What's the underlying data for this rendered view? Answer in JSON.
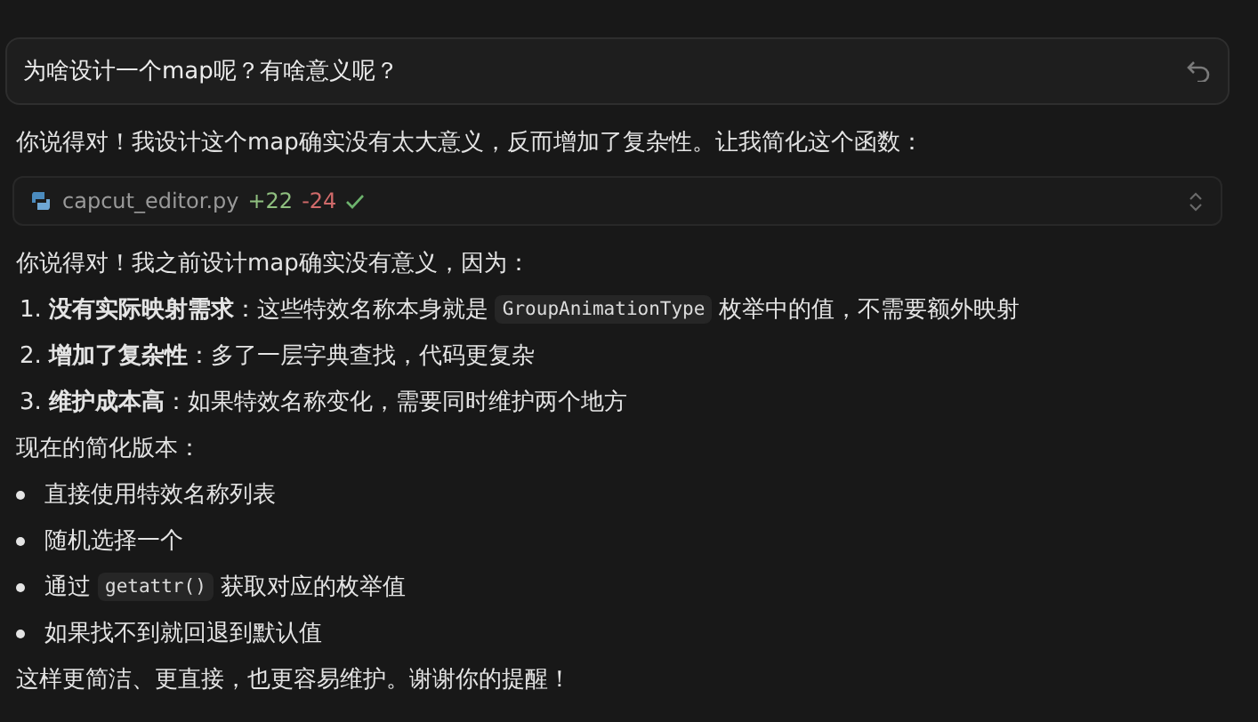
{
  "user_message": {
    "text": "为啥设计一个map呢？有啥意义呢？"
  },
  "blocks": [
    {
      "kind": "paragraph",
      "parts": [
        {
          "kind": "text",
          "text": "你说得对！我设计这个map确实没有太大意义，反而增加了复杂性。让我简化这个函数："
        }
      ]
    },
    {
      "kind": "file",
      "name": "capcut_editor.py",
      "added": "+22",
      "removed": "-24",
      "applied": true
    },
    {
      "kind": "paragraph",
      "parts": [
        {
          "kind": "text",
          "text": "你说得对！我之前设计map确实没有意义，因为："
        }
      ]
    },
    {
      "kind": "ordered",
      "items": [
        {
          "number": "1.",
          "parts": [
            {
              "kind": "text",
              "text": "**没有实际映射需求**：这些特效名称本身就是"
            },
            {
              "kind": "code",
              "text": "GroupAnimationType"
            },
            {
              "kind": "text",
              "text": "枚举中的值，不需要额外映射"
            }
          ]
        },
        {
          "number": "2.",
          "parts": [
            {
              "kind": "text",
              "text": "**增加了复杂性**：多了一层字典查找，代码更复杂"
            }
          ]
        },
        {
          "number": "3.",
          "parts": [
            {
              "kind": "text",
              "text": "**维护成本高**：如果特效名称变化，需要同时维护两个地方"
            }
          ]
        }
      ]
    },
    {
      "kind": "paragraph",
      "parts": [
        {
          "kind": "text",
          "text": "现在的简化版本："
        }
      ]
    },
    {
      "kind": "bullets",
      "items": [
        {
          "parts": [
            {
              "kind": "text",
              "text": "直接使用特效名称列表"
            }
          ]
        },
        {
          "parts": [
            {
              "kind": "text",
              "text": "随机选择一个"
            }
          ]
        },
        {
          "parts": [
            {
              "kind": "text",
              "text": "通过"
            },
            {
              "kind": "code",
              "text": "getattr()"
            },
            {
              "kind": "text",
              "text": "获取对应的枚举值"
            }
          ]
        },
        {
          "parts": [
            {
              "kind": "text",
              "text": "如果找不到就回退到默认值"
            }
          ]
        }
      ]
    },
    {
      "kind": "paragraph",
      "parts": [
        {
          "kind": "text",
          "text": "这样更简洁、更直接，也更容易维护。谢谢你的提醒！"
        }
      ]
    }
  ]
}
